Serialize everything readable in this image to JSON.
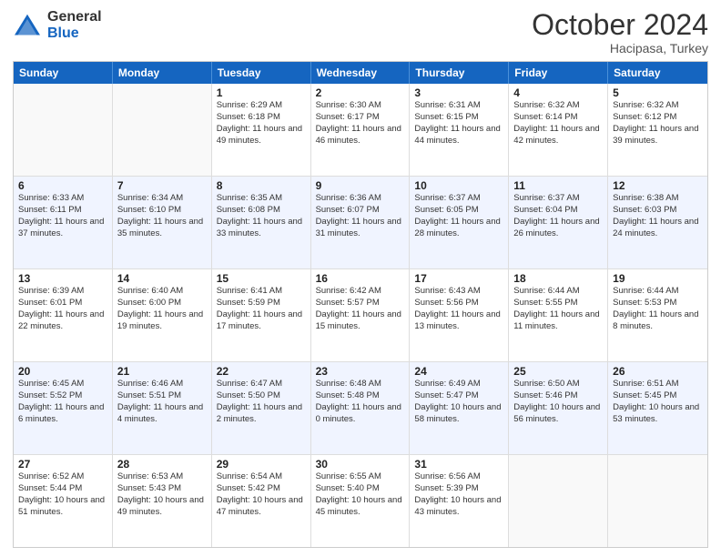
{
  "logo": {
    "general": "General",
    "blue": "Blue"
  },
  "header": {
    "month": "October 2024",
    "location": "Hacipasa, Turkey"
  },
  "weekdays": [
    "Sunday",
    "Monday",
    "Tuesday",
    "Wednesday",
    "Thursday",
    "Friday",
    "Saturday"
  ],
  "rows": [
    [
      {
        "day": "",
        "info": ""
      },
      {
        "day": "",
        "info": ""
      },
      {
        "day": "1",
        "info": "Sunrise: 6:29 AM\nSunset: 6:18 PM\nDaylight: 11 hours and 49 minutes."
      },
      {
        "day": "2",
        "info": "Sunrise: 6:30 AM\nSunset: 6:17 PM\nDaylight: 11 hours and 46 minutes."
      },
      {
        "day": "3",
        "info": "Sunrise: 6:31 AM\nSunset: 6:15 PM\nDaylight: 11 hours and 44 minutes."
      },
      {
        "day": "4",
        "info": "Sunrise: 6:32 AM\nSunset: 6:14 PM\nDaylight: 11 hours and 42 minutes."
      },
      {
        "day": "5",
        "info": "Sunrise: 6:32 AM\nSunset: 6:12 PM\nDaylight: 11 hours and 39 minutes."
      }
    ],
    [
      {
        "day": "6",
        "info": "Sunrise: 6:33 AM\nSunset: 6:11 PM\nDaylight: 11 hours and 37 minutes."
      },
      {
        "day": "7",
        "info": "Sunrise: 6:34 AM\nSunset: 6:10 PM\nDaylight: 11 hours and 35 minutes."
      },
      {
        "day": "8",
        "info": "Sunrise: 6:35 AM\nSunset: 6:08 PM\nDaylight: 11 hours and 33 minutes."
      },
      {
        "day": "9",
        "info": "Sunrise: 6:36 AM\nSunset: 6:07 PM\nDaylight: 11 hours and 31 minutes."
      },
      {
        "day": "10",
        "info": "Sunrise: 6:37 AM\nSunset: 6:05 PM\nDaylight: 11 hours and 28 minutes."
      },
      {
        "day": "11",
        "info": "Sunrise: 6:37 AM\nSunset: 6:04 PM\nDaylight: 11 hours and 26 minutes."
      },
      {
        "day": "12",
        "info": "Sunrise: 6:38 AM\nSunset: 6:03 PM\nDaylight: 11 hours and 24 minutes."
      }
    ],
    [
      {
        "day": "13",
        "info": "Sunrise: 6:39 AM\nSunset: 6:01 PM\nDaylight: 11 hours and 22 minutes."
      },
      {
        "day": "14",
        "info": "Sunrise: 6:40 AM\nSunset: 6:00 PM\nDaylight: 11 hours and 19 minutes."
      },
      {
        "day": "15",
        "info": "Sunrise: 6:41 AM\nSunset: 5:59 PM\nDaylight: 11 hours and 17 minutes."
      },
      {
        "day": "16",
        "info": "Sunrise: 6:42 AM\nSunset: 5:57 PM\nDaylight: 11 hours and 15 minutes."
      },
      {
        "day": "17",
        "info": "Sunrise: 6:43 AM\nSunset: 5:56 PM\nDaylight: 11 hours and 13 minutes."
      },
      {
        "day": "18",
        "info": "Sunrise: 6:44 AM\nSunset: 5:55 PM\nDaylight: 11 hours and 11 minutes."
      },
      {
        "day": "19",
        "info": "Sunrise: 6:44 AM\nSunset: 5:53 PM\nDaylight: 11 hours and 8 minutes."
      }
    ],
    [
      {
        "day": "20",
        "info": "Sunrise: 6:45 AM\nSunset: 5:52 PM\nDaylight: 11 hours and 6 minutes."
      },
      {
        "day": "21",
        "info": "Sunrise: 6:46 AM\nSunset: 5:51 PM\nDaylight: 11 hours and 4 minutes."
      },
      {
        "day": "22",
        "info": "Sunrise: 6:47 AM\nSunset: 5:50 PM\nDaylight: 11 hours and 2 minutes."
      },
      {
        "day": "23",
        "info": "Sunrise: 6:48 AM\nSunset: 5:48 PM\nDaylight: 11 hours and 0 minutes."
      },
      {
        "day": "24",
        "info": "Sunrise: 6:49 AM\nSunset: 5:47 PM\nDaylight: 10 hours and 58 minutes."
      },
      {
        "day": "25",
        "info": "Sunrise: 6:50 AM\nSunset: 5:46 PM\nDaylight: 10 hours and 56 minutes."
      },
      {
        "day": "26",
        "info": "Sunrise: 6:51 AM\nSunset: 5:45 PM\nDaylight: 10 hours and 53 minutes."
      }
    ],
    [
      {
        "day": "27",
        "info": "Sunrise: 6:52 AM\nSunset: 5:44 PM\nDaylight: 10 hours and 51 minutes."
      },
      {
        "day": "28",
        "info": "Sunrise: 6:53 AM\nSunset: 5:43 PM\nDaylight: 10 hours and 49 minutes."
      },
      {
        "day": "29",
        "info": "Sunrise: 6:54 AM\nSunset: 5:42 PM\nDaylight: 10 hours and 47 minutes."
      },
      {
        "day": "30",
        "info": "Sunrise: 6:55 AM\nSunset: 5:40 PM\nDaylight: 10 hours and 45 minutes."
      },
      {
        "day": "31",
        "info": "Sunrise: 6:56 AM\nSunset: 5:39 PM\nDaylight: 10 hours and 43 minutes."
      },
      {
        "day": "",
        "info": ""
      },
      {
        "day": "",
        "info": ""
      }
    ]
  ]
}
